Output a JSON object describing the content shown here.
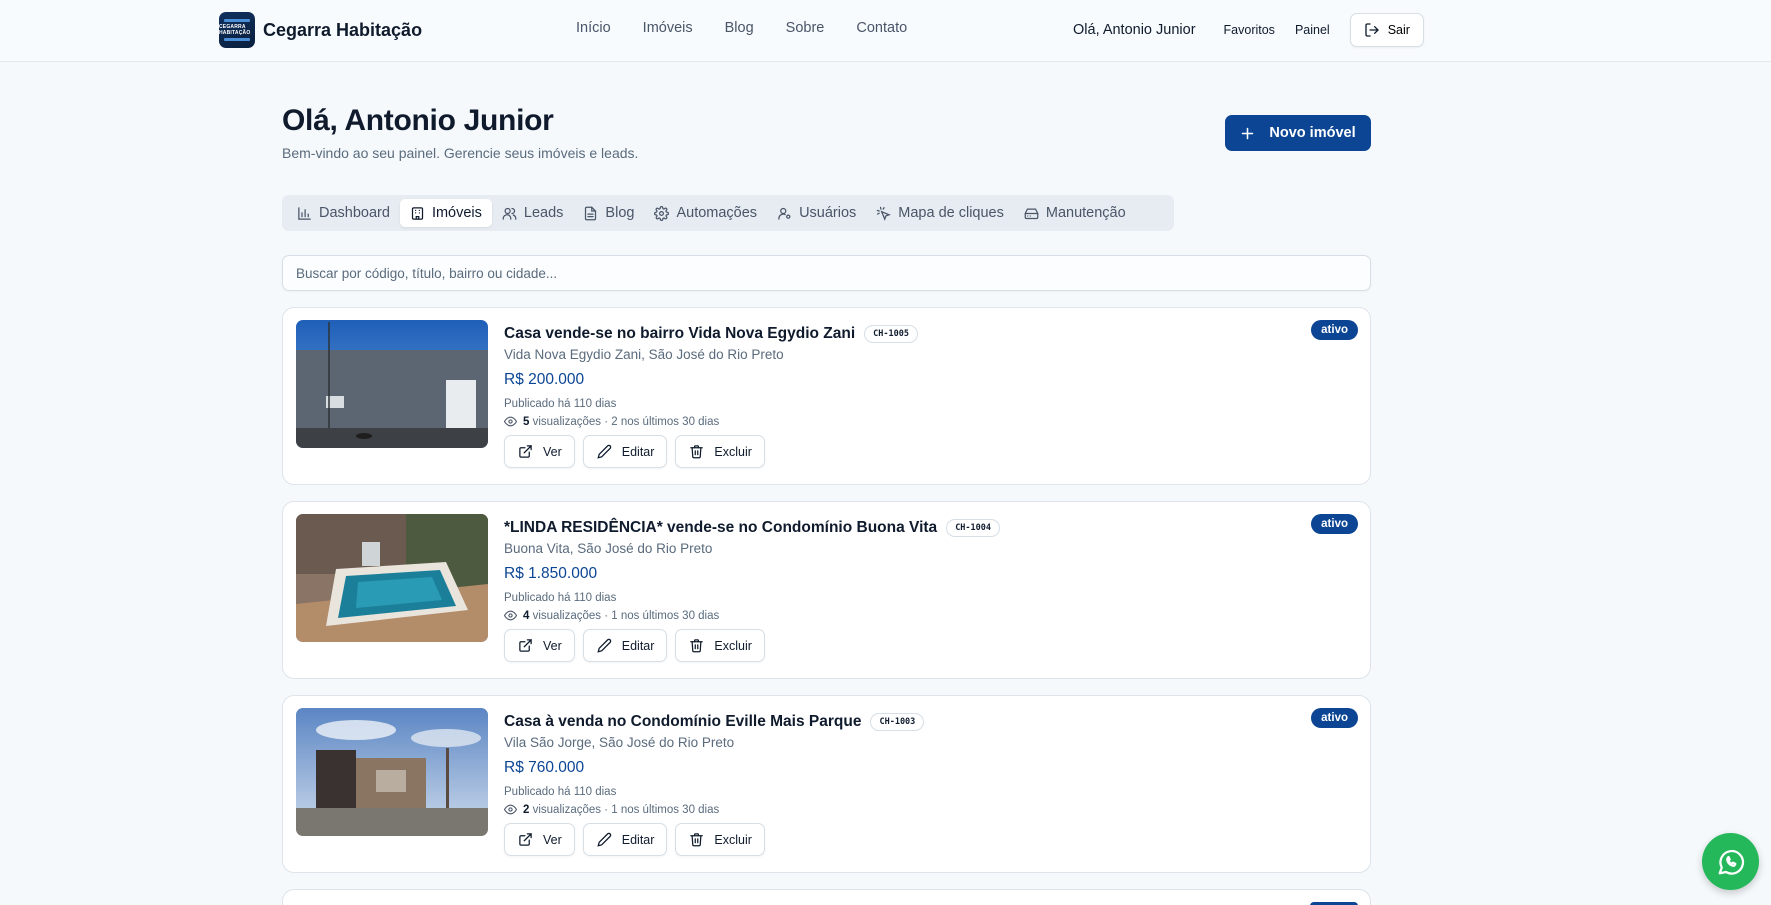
{
  "header": {
    "brand_name": "Cegarra Habitação",
    "logo_text": "CEGARRA HABITAÇÃO",
    "nav": [
      "Início",
      "Imóveis",
      "Blog",
      "Sobre",
      "Contato"
    ],
    "greeting": "Olá, Antonio Junior",
    "favorites": "Favoritos",
    "panel": "Painel",
    "logout": "Sair"
  },
  "page": {
    "title": "Olá, Antonio Junior",
    "subtitle": "Bem-vindo ao seu painel. Gerencie seus imóveis e leads.",
    "new_button": "Novo imóvel"
  },
  "tabs": [
    {
      "label": "Dashboard",
      "icon": "bar-chart-icon"
    },
    {
      "label": "Imóveis",
      "icon": "building-icon",
      "active": true
    },
    {
      "label": "Leads",
      "icon": "users-icon"
    },
    {
      "label": "Blog",
      "icon": "file-text-icon"
    },
    {
      "label": "Automações",
      "icon": "gear-icon"
    },
    {
      "label": "Usuários",
      "icon": "user-key-icon"
    },
    {
      "label": "Mapa de cliques",
      "icon": "click-icon"
    },
    {
      "label": "Manutenção",
      "icon": "hard-drive-icon"
    }
  ],
  "search": {
    "placeholder": "Buscar por código, título, bairro ou cidade..."
  },
  "listings": [
    {
      "title": "Casa vende-se no bairro Vida Nova Egydio Zani",
      "code": "CH-1005",
      "location": "Vida Nova Egydio Zani, São José do Rio Preto",
      "price": "R$ 200.000",
      "published": "Publicado há 110 dias",
      "views_count": "5",
      "views_text": "visualizações · 2 nos últimos 30 dias",
      "status": "ativo"
    },
    {
      "title": "*LINDA RESIDÊNCIA* vende-se no Condomínio Buona Vita",
      "code": "CH-1004",
      "location": "Buona Vita, São José do Rio Preto",
      "price": "R$ 1.850.000",
      "published": "Publicado há 110 dias",
      "views_count": "4",
      "views_text": "visualizações · 1 nos últimos 30 dias",
      "status": "ativo"
    },
    {
      "title": "Casa à venda no Condomínio Eville Mais Parque",
      "code": "CH-1003",
      "location": "Vila São Jorge, São José do Rio Preto",
      "price": "R$ 760.000",
      "published": "Publicado há 110 dias",
      "views_count": "2",
      "views_text": "visualizações · 1 nos últimos 30 dias",
      "status": "ativo"
    }
  ],
  "actions": {
    "view": "Ver",
    "edit": "Editar",
    "delete": "Excluir"
  },
  "colors": {
    "primary": "#0b4594",
    "background": "#f5f9fc",
    "whatsapp": "#25b85a"
  }
}
